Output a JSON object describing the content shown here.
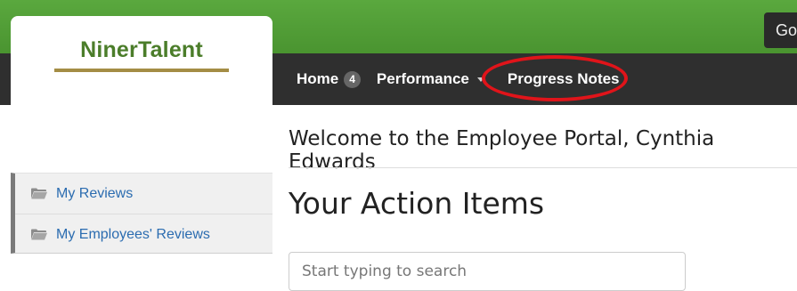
{
  "header": {
    "logo_text": "NinerTalent",
    "go_button_label": "Go"
  },
  "nav": {
    "home_label": "Home",
    "home_badge": "4",
    "performance_label": "Performance",
    "progress_notes_label": "Progress Notes"
  },
  "main": {
    "welcome_text": "Welcome to the Employee Portal, Cynthia Edwards",
    "action_items_title": "Your Action Items",
    "search_placeholder": "Start typing to search"
  },
  "sidebar": {
    "items": [
      {
        "label": "My Reviews",
        "icon": "folder-icon"
      },
      {
        "label": "My Employees' Reviews",
        "icon": "folder-icon"
      }
    ]
  },
  "colors": {
    "brand_green": "#4a9430",
    "nav_dark": "#2f2f2f",
    "logo_green": "#4b7d2a",
    "logo_underline": "#a48d45",
    "link_blue": "#2b6cb0",
    "highlight_red": "#e0141a"
  }
}
